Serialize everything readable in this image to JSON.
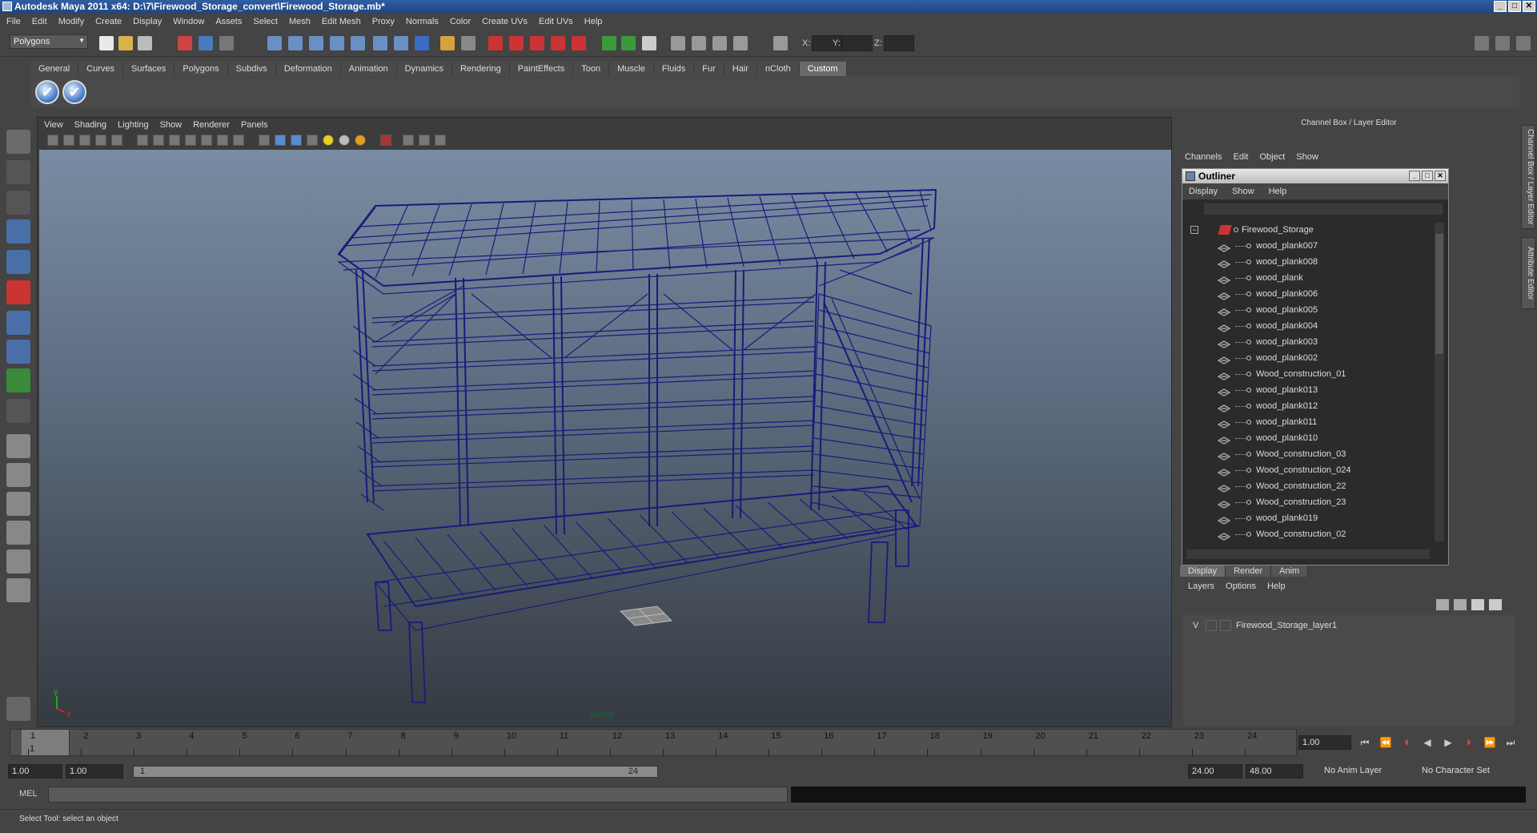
{
  "window": {
    "title": "Autodesk Maya 2011 x64: D:\\7\\Firewood_Storage_convert\\Firewood_Storage.mb*",
    "controls": [
      "_",
      "□",
      "✕"
    ]
  },
  "menubar": [
    "File",
    "Edit",
    "Modify",
    "Create",
    "Display",
    "Window",
    "Assets",
    "Select",
    "Mesh",
    "Edit Mesh",
    "Proxy",
    "Normals",
    "Color",
    "Create UVs",
    "Edit UVs",
    "Help"
  ],
  "status": {
    "menuset": "Polygons",
    "x_label": "X:",
    "y_label": "Y:",
    "z_label": "Z:"
  },
  "shelf": {
    "tabs": [
      "General",
      "Curves",
      "Surfaces",
      "Polygons",
      "Subdivs",
      "Deformation",
      "Animation",
      "Dynamics",
      "Rendering",
      "PaintEffects",
      "Toon",
      "Muscle",
      "Fluids",
      "Fur",
      "Hair",
      "nCloth",
      "Custom"
    ],
    "active": "Custom"
  },
  "panel": {
    "menu": [
      "View",
      "Shading",
      "Lighting",
      "Show",
      "Renderer",
      "Panels"
    ],
    "camera": "persp"
  },
  "channelbox": {
    "title": "Channel Box / Layer Editor",
    "menu": [
      "Channels",
      "Edit",
      "Object",
      "Show"
    ]
  },
  "sidetabs": [
    "Channel Box / Layer Editor",
    "Attribute Editor"
  ],
  "outliner": {
    "title": "Outliner",
    "menu": [
      "Display",
      "Show",
      "Help"
    ],
    "root": "Firewood_Storage",
    "items": [
      "wood_plank007",
      "wood_plank008",
      "wood_plank",
      "wood_plank006",
      "wood_plank005",
      "wood_plank004",
      "wood_plank003",
      "wood_plank002",
      "Wood_construction_01",
      "wood_plank013",
      "wood_plank012",
      "wood_plank011",
      "wood_plank010",
      "Wood_construction_03",
      "Wood_construction_024",
      "Wood_construction_22",
      "Wood_construction_23",
      "wood_plank019",
      "Wood_construction_02"
    ]
  },
  "layers": {
    "tabs": [
      "Display",
      "Render",
      "Anim"
    ],
    "menu": [
      "Layers",
      "Options",
      "Help"
    ],
    "visible_flag": "V",
    "layer_name": "Firewood_Storage_layer1"
  },
  "time": {
    "ticks": [
      "1",
      "2",
      "3",
      "4",
      "5",
      "6",
      "7",
      "8",
      "9",
      "10",
      "11",
      "12",
      "13",
      "14",
      "15",
      "16",
      "17",
      "18",
      "19",
      "20",
      "21",
      "22",
      "23",
      "24"
    ],
    "current_marker": "1",
    "current": "1.00",
    "range_start": "1.00",
    "range_inner_start": "1.00",
    "range_bar_start": "1",
    "range_bar_end": "24",
    "range_end": "24.00",
    "range_outer_end": "48.00",
    "anim_layer": "No Anim Layer",
    "char_set": "No Character Set"
  },
  "command": {
    "label": "MEL"
  },
  "help": {
    "text": "Select Tool: select an object"
  },
  "colors": {
    "wire": "#1a1a7a",
    "title_bar": "#2e5fa3",
    "persp_label": "#0a6b35"
  }
}
